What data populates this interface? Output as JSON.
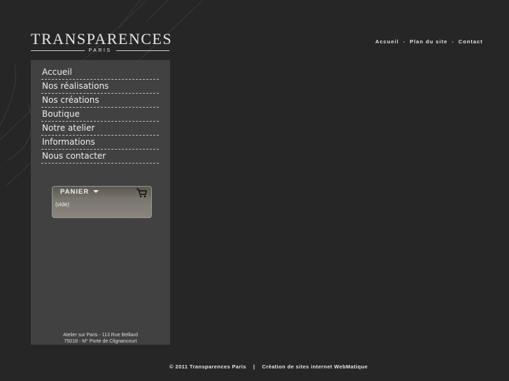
{
  "logo": {
    "main": "TRANSPARENCES",
    "sub": "PARIS"
  },
  "top_nav": {
    "items": [
      "Accueil",
      "Plan du site",
      "Contact"
    ],
    "separator": "-"
  },
  "menu": {
    "items": [
      "Accueil",
      "Nos réalisations",
      "Nos créations",
      "Boutique",
      "Notre atelier",
      "Informations",
      "Nous contacter"
    ]
  },
  "cart": {
    "title": "PANIER",
    "status": "(vide)",
    "icon": "shopping-cart-icon"
  },
  "address": {
    "line1": "Atelier sur Paris - 113 Rue Belliard",
    "line2": "75018 - M° Porte de Clignancourt"
  },
  "footer": {
    "copyright": "© 2011 Transparences Paris",
    "separator": "|",
    "credit": "Création de sites internet WebMatique"
  },
  "colors": {
    "background": "#262626",
    "panel": "#414141",
    "text": "#e6e6e6"
  }
}
